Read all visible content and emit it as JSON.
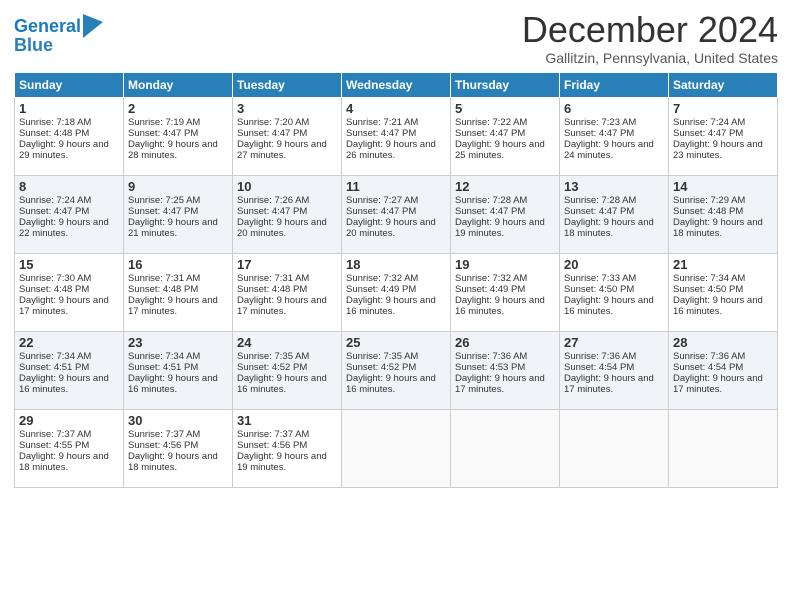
{
  "logo": {
    "text_general": "General",
    "text_blue": "Blue"
  },
  "title": "December 2024",
  "location": "Gallitzin, Pennsylvania, United States",
  "days_of_week": [
    "Sunday",
    "Monday",
    "Tuesday",
    "Wednesday",
    "Thursday",
    "Friday",
    "Saturday"
  ],
  "weeks": [
    [
      {
        "day": 1,
        "sunrise": "7:18 AM",
        "sunset": "4:48 PM",
        "daylight": "9 hours and 29 minutes."
      },
      {
        "day": 2,
        "sunrise": "7:19 AM",
        "sunset": "4:47 PM",
        "daylight": "9 hours and 28 minutes."
      },
      {
        "day": 3,
        "sunrise": "7:20 AM",
        "sunset": "4:47 PM",
        "daylight": "9 hours and 27 minutes."
      },
      {
        "day": 4,
        "sunrise": "7:21 AM",
        "sunset": "4:47 PM",
        "daylight": "9 hours and 26 minutes."
      },
      {
        "day": 5,
        "sunrise": "7:22 AM",
        "sunset": "4:47 PM",
        "daylight": "9 hours and 25 minutes."
      },
      {
        "day": 6,
        "sunrise": "7:23 AM",
        "sunset": "4:47 PM",
        "daylight": "9 hours and 24 minutes."
      },
      {
        "day": 7,
        "sunrise": "7:24 AM",
        "sunset": "4:47 PM",
        "daylight": "9 hours and 23 minutes."
      }
    ],
    [
      {
        "day": 8,
        "sunrise": "7:24 AM",
        "sunset": "4:47 PM",
        "daylight": "9 hours and 22 minutes."
      },
      {
        "day": 9,
        "sunrise": "7:25 AM",
        "sunset": "4:47 PM",
        "daylight": "9 hours and 21 minutes."
      },
      {
        "day": 10,
        "sunrise": "7:26 AM",
        "sunset": "4:47 PM",
        "daylight": "9 hours and 20 minutes."
      },
      {
        "day": 11,
        "sunrise": "7:27 AM",
        "sunset": "4:47 PM",
        "daylight": "9 hours and 20 minutes."
      },
      {
        "day": 12,
        "sunrise": "7:28 AM",
        "sunset": "4:47 PM",
        "daylight": "9 hours and 19 minutes."
      },
      {
        "day": 13,
        "sunrise": "7:28 AM",
        "sunset": "4:47 PM",
        "daylight": "9 hours and 18 minutes."
      },
      {
        "day": 14,
        "sunrise": "7:29 AM",
        "sunset": "4:48 PM",
        "daylight": "9 hours and 18 minutes."
      }
    ],
    [
      {
        "day": 15,
        "sunrise": "7:30 AM",
        "sunset": "4:48 PM",
        "daylight": "9 hours and 17 minutes."
      },
      {
        "day": 16,
        "sunrise": "7:31 AM",
        "sunset": "4:48 PM",
        "daylight": "9 hours and 17 minutes."
      },
      {
        "day": 17,
        "sunrise": "7:31 AM",
        "sunset": "4:48 PM",
        "daylight": "9 hours and 17 minutes."
      },
      {
        "day": 18,
        "sunrise": "7:32 AM",
        "sunset": "4:49 PM",
        "daylight": "9 hours and 16 minutes."
      },
      {
        "day": 19,
        "sunrise": "7:32 AM",
        "sunset": "4:49 PM",
        "daylight": "9 hours and 16 minutes."
      },
      {
        "day": 20,
        "sunrise": "7:33 AM",
        "sunset": "4:50 PM",
        "daylight": "9 hours and 16 minutes."
      },
      {
        "day": 21,
        "sunrise": "7:34 AM",
        "sunset": "4:50 PM",
        "daylight": "9 hours and 16 minutes."
      }
    ],
    [
      {
        "day": 22,
        "sunrise": "7:34 AM",
        "sunset": "4:51 PM",
        "daylight": "9 hours and 16 minutes."
      },
      {
        "day": 23,
        "sunrise": "7:34 AM",
        "sunset": "4:51 PM",
        "daylight": "9 hours and 16 minutes."
      },
      {
        "day": 24,
        "sunrise": "7:35 AM",
        "sunset": "4:52 PM",
        "daylight": "9 hours and 16 minutes."
      },
      {
        "day": 25,
        "sunrise": "7:35 AM",
        "sunset": "4:52 PM",
        "daylight": "9 hours and 16 minutes."
      },
      {
        "day": 26,
        "sunrise": "7:36 AM",
        "sunset": "4:53 PM",
        "daylight": "9 hours and 17 minutes."
      },
      {
        "day": 27,
        "sunrise": "7:36 AM",
        "sunset": "4:54 PM",
        "daylight": "9 hours and 17 minutes."
      },
      {
        "day": 28,
        "sunrise": "7:36 AM",
        "sunset": "4:54 PM",
        "daylight": "9 hours and 17 minutes."
      }
    ],
    [
      {
        "day": 29,
        "sunrise": "7:37 AM",
        "sunset": "4:55 PM",
        "daylight": "9 hours and 18 minutes."
      },
      {
        "day": 30,
        "sunrise": "7:37 AM",
        "sunset": "4:56 PM",
        "daylight": "9 hours and 18 minutes."
      },
      {
        "day": 31,
        "sunrise": "7:37 AM",
        "sunset": "4:56 PM",
        "daylight": "9 hours and 19 minutes."
      },
      null,
      null,
      null,
      null
    ]
  ]
}
